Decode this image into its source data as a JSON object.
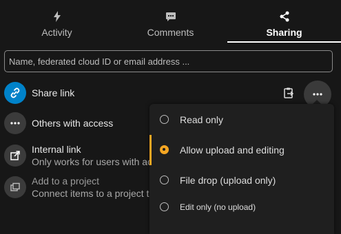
{
  "tabs": [
    {
      "label": "Activity",
      "icon": "lightning-icon"
    },
    {
      "label": "Comments",
      "icon": "comment-icon"
    },
    {
      "label": "Sharing",
      "icon": "share-icon",
      "active": true
    }
  ],
  "search": {
    "placeholder": "Name, federated cloud ID or email address ..."
  },
  "rows": {
    "share_link": {
      "title": "Share link",
      "icon": "link-icon",
      "accent": "#0082c9"
    },
    "others": {
      "title": "Others with access",
      "icon": "ellipsis-icon"
    },
    "internal": {
      "title": "Internal link",
      "subtitle": "Only works for users with ac",
      "icon": "external-link-icon"
    },
    "project": {
      "title": "Add to a project",
      "subtitle": "Connect items to a project t",
      "icon": "project-icon"
    }
  },
  "popup": {
    "options": [
      {
        "label": "Read only",
        "selected": false
      },
      {
        "label": "Allow upload and editing",
        "selected": true
      },
      {
        "label": "File drop (upload only)",
        "selected": false
      },
      {
        "label": "Edit only (no upload)",
        "selected": false
      }
    ]
  },
  "colors": {
    "accent": "#f5a623",
    "link_blue": "#0082c9",
    "background": "#171717"
  }
}
